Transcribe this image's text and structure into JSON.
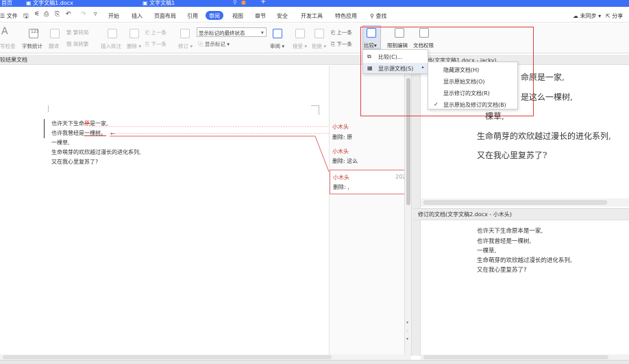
{
  "title_tabs": [
    "首页",
    "文字文稿1.docx",
    "文字文稿1"
  ],
  "title_plus": "+",
  "menu": {
    "file": "文件",
    "tabs": [
      "开始",
      "插入",
      "页面布局",
      "引用",
      "审阅",
      "视图",
      "章节",
      "安全",
      "开发工具",
      "特色应用"
    ],
    "active_tab": "审阅",
    "search": "查找",
    "sync": "未同步",
    "share": "分享"
  },
  "ribbon": {
    "spell": "写检查",
    "wordcount": "字数统计",
    "translate": "翻译",
    "simp_trad": "繁转简",
    "trad_simp": "简转繁",
    "insert_comment": "插入批注",
    "delete": "删除",
    "prev": "上一条",
    "next": "下一条",
    "revise": "修订",
    "markup_select": "显示标记的最终状态",
    "show_markup": "显示标记",
    "review": "审阅",
    "accept": "接受",
    "reject": "拒绝",
    "prev2": "上一条",
    "next2": "下一条",
    "compare": "比较",
    "restrict": "限制编辑",
    "doc_rights": "文档权限"
  },
  "compare_menu": {
    "item1": "比较(C)...",
    "item2": "显示源文档(S)"
  },
  "submenu": {
    "items": [
      "隐藏源文档(H)",
      "显示原始文档(O)",
      "显示修订的文档(R)",
      "显示原始及修订的文档(B)"
    ],
    "checked_index": 3
  },
  "left_panel_title": "较结果文档",
  "right_top_title": "档(文字文稿1.docx - jacky)",
  "right_bottom_title": "修订的文档(文字文稿2.docx - 小木头)",
  "left_doc": {
    "l1a": "也许天下生命",
    "l1b": "原",
    "l1c": "是一家,",
    "l2a": "也许我曾经是",
    "l2b": "一棵树。",
    "l3": "一棵草,",
    "l4": "生命萌芽的欢欣越过漫长的进化系列,",
    "l5": "又在我心里复苏了?"
  },
  "comments": [
    {
      "author": "小木头",
      "text": "删除: 原"
    },
    {
      "author": "小木头",
      "text": "删除: 这么"
    },
    {
      "author": "小木头",
      "text": "删除: ,",
      "date": "202"
    }
  ],
  "right_top_lines": [
    "命原是一家,",
    "是这么一棵树,",
    "一棵草,",
    "生命萌芽的欢欣越过漫长的进化系列,",
    "又在我心里复苏了?"
  ],
  "right_bottom_lines": [
    "也许天下生命原本是一家,",
    "也许我曾经是一棵树,",
    "一棵草,",
    "生命萌芽的欢欣越过漫长的进化系列,",
    "又在我心里复苏了?"
  ],
  "colors": {
    "accent": "#3b6ff5",
    "highlight_box": "#e53935",
    "comment": "#c0392b"
  }
}
